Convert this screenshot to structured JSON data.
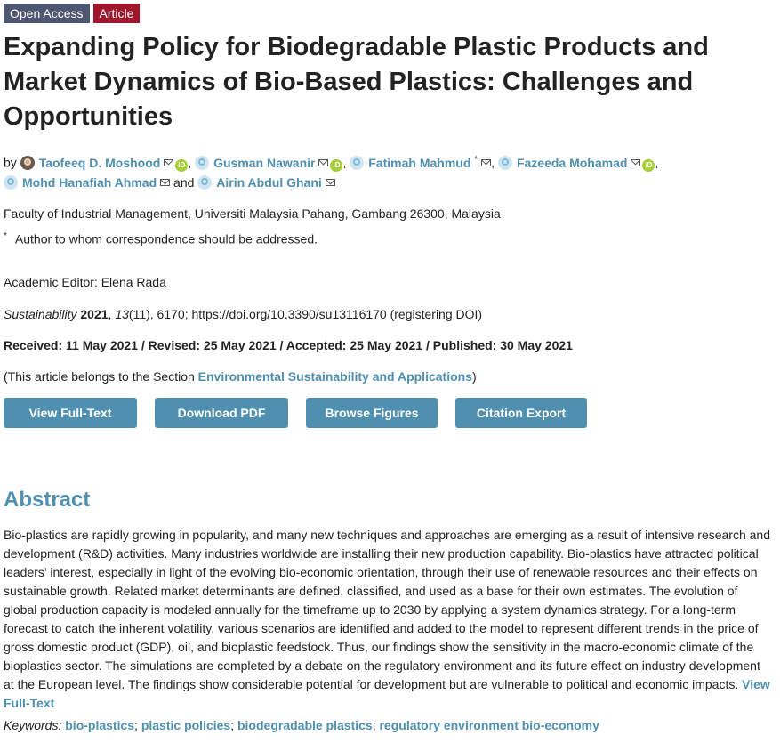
{
  "badges": {
    "open_access": "Open Access",
    "article": "Article"
  },
  "title": "Expanding Policy for Biodegradable Plastic Products and Market Dynamics of Bio-Based Plastics: Challenges and Opportunities",
  "authors": {
    "by": "by",
    "list": [
      {
        "name": "Taofeeq D. Moshood"
      },
      {
        "name": "Gusman Nawanir"
      },
      {
        "name": "Fatimah Mahmud",
        "corresponding_mark": "*"
      },
      {
        "name": "Fazeeda Mohamad"
      },
      {
        "name": "Mohd Hanafiah Ahmad"
      },
      {
        "name": "Airin Abdul Ghani"
      }
    ],
    "and": "and",
    "comma": ","
  },
  "affiliation": "Faculty of Industrial Management, Universiti Malaysia Pahang, Gambang 26300, Malaysia",
  "correspondence": {
    "mark": "*",
    "text": "Author to whom correspondence should be addressed."
  },
  "editor": "Academic Editor: Elena Rada",
  "citation": {
    "journal": "Sustainability",
    "year": "2021",
    "volume": "13",
    "rest": "(11), 6170; https://doi.org/10.3390/su13116170 (registering DOI)"
  },
  "dates": "Received: 11 May 2021 / Revised: 25 May 2021 / Accepted: 25 May 2021 / Published: 30 May 2021",
  "section": {
    "prefix": "(This article belongs to the Section ",
    "link": "Environmental Sustainability and Applications",
    "suffix": ")"
  },
  "buttons": {
    "full_text": "View Full-Text",
    "pdf": "Download PDF",
    "figures": "Browse Figures",
    "citation": "Citation Export"
  },
  "abstract": {
    "heading": "Abstract",
    "text": "Bio-plastics are rapidly growing in popularity, and many new techniques and approaches are emerging as a result of intensive research and development (R&D) activities. Many industries worldwide are installing their new production capability. Bio-plastics have attracted political leaders’ interest, especially in light of the evolving bio-economic orientation, through their use of renewable resources and their effects on sustainable growth. Related market determinants are defined, classified, and used as a base for their own estimates. The evolution of global production capacity is modeled annually for the timeframe up to 2030 by applying a system dynamics strategy. For a long-term forecast to catch the inherent volatility, various scenarios are identified and added to the model to represent different trends in the price of gross domestic product (GDP), oil, and bioplastic feedstock. Thus, our findings show the sensitivity in the macro-economic climate of the bioplastics sector. The simulations are completed by a debate on the regulatory environment and its future effect on industry development at the European level. The findings show considerable potential for development but are vulnerable to political and economic impacts.",
    "link": "View Full-Text"
  },
  "keywords": {
    "label": "Keywords:",
    "items": [
      "bio-plastics",
      "plastic policies",
      "biodegradable plastics",
      "regulatory environment bio-economy"
    ],
    "sep": ";"
  }
}
